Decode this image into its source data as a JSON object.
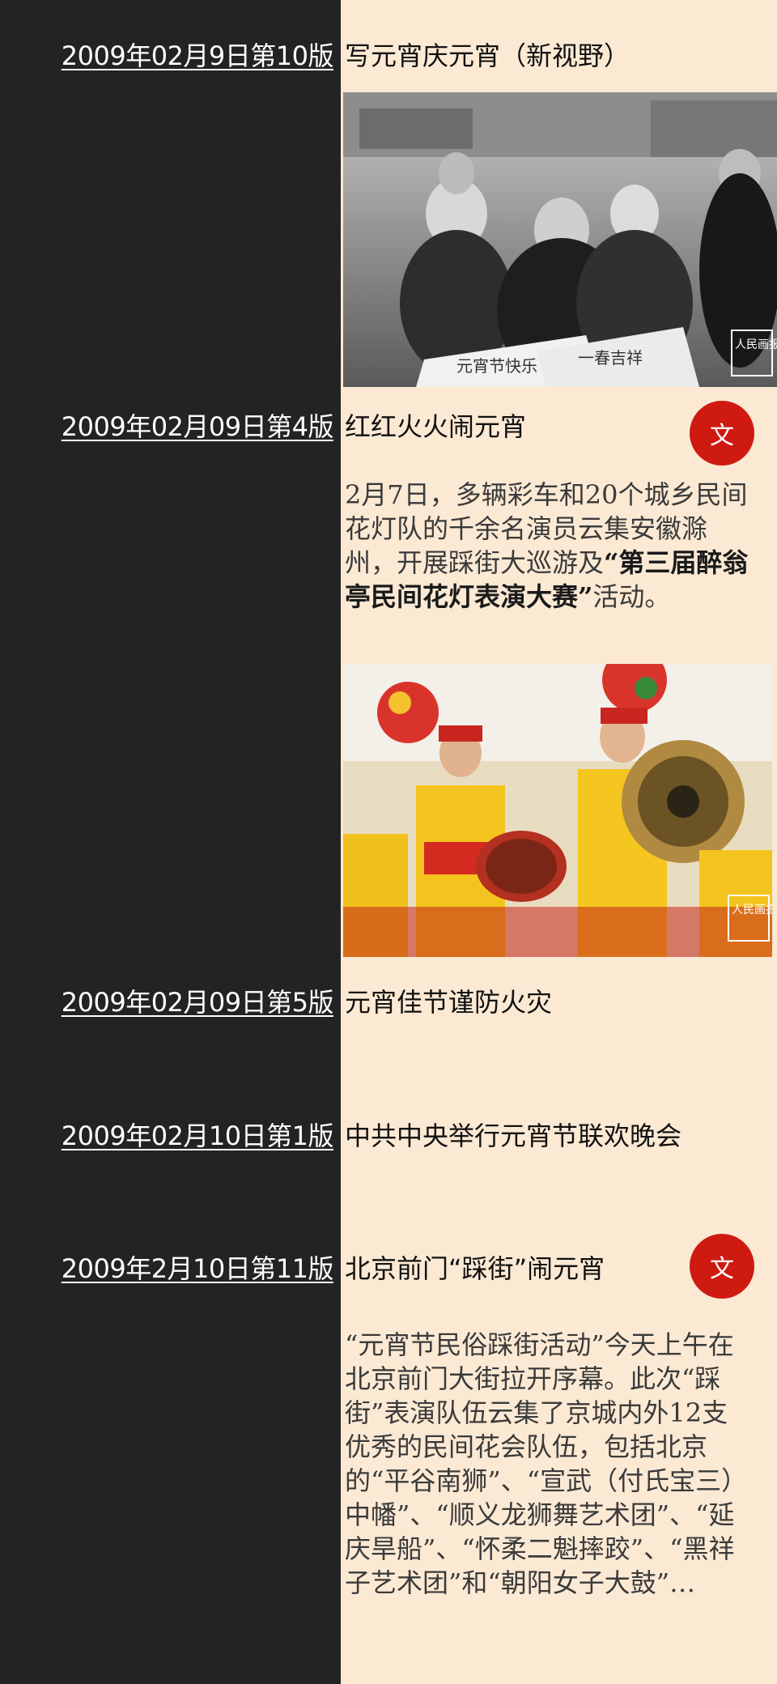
{
  "entries": [
    {
      "date": "2009年02月9日第10版",
      "title": "写元宵庆元宵（新视野）"
    },
    {
      "date": "2009年02月09日第4版",
      "title": "红红火火闹元宵",
      "badge": "文",
      "summary_pre": "2月7日，多辆彩车和20个城乡民间花灯队的千余名演员云集安徽滁州，开展踩街大巡游及",
      "summary_bold": "“第三届醉翁亭民间花灯表演大赛”",
      "summary_post": "活动。"
    },
    {
      "date": "2009年02月09日第5版",
      "title": "元宵佳节谨防火灾"
    },
    {
      "date": "2009年02月10日第1版",
      "title": "中共中央举行元宵节联欢晚会"
    },
    {
      "date": "2009年2月10日第11版",
      "title": "北京前门“踩街”闹元宵",
      "badge": "文",
      "summary": "“元宵节民俗踩街活动”今天上午在北京前门大街拉开序幕。此次“踩街”表演队伍云集了京城内外12支优秀的民间花会队伍，包括北京的“平谷南狮”、“宣武（付氏宝三）中幡”、“顺义龙狮舞艺术团”、“延庆旱船”、“怀柔二魁摔跤”、“黑祥子艺术团”和“朝阳女子大鼓”…"
    }
  ],
  "photos": {
    "calligraphy": {
      "watermark": "人民画报"
    },
    "drummers": {
      "watermark": "人民画报"
    }
  },
  "colors": {
    "left_bg": "#232323",
    "right_bg": "#fbe9d4",
    "badge": "#cf1a12"
  }
}
